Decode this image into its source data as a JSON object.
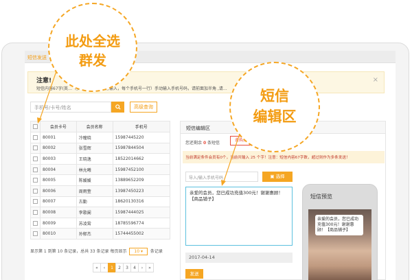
{
  "top_tab": "短信发送",
  "callouts": {
    "left_line1": "此处全选",
    "left_line2": "群发",
    "right_line1": "短信",
    "right_line2": "编辑区"
  },
  "notice": {
    "title": "注意!",
    "text": "短信内容67字(英…（多个手机号码换行输入，每个手机号一行）手动输入手机号码，请前面加半角 ,请…",
    "close": "×"
  },
  "search": {
    "placeholder": "手机号/卡号/姓名",
    "button_icon": "search-icon",
    "query_label": "高级查询"
  },
  "table": {
    "headers": [
      "会员卡号",
      "会员名称",
      "手机号"
    ],
    "rows": [
      [
        "80001",
        "冷瞳晓",
        "15987445220"
      ],
      [
        "80002",
        "张雪辉",
        "15987844504"
      ],
      [
        "80003",
        "王晓逸",
        "18522014662"
      ],
      [
        "80004",
        "林允曦",
        "15987452100"
      ],
      [
        "80005",
        "陈媛媛",
        "13889652209"
      ],
      [
        "80006",
        "周雨萱",
        "13987450223"
      ],
      [
        "80007",
        "古勤",
        "18620130316"
      ],
      [
        "80008",
        "李歌阑",
        "15987444025"
      ],
      [
        "80009",
        "苏凌霄",
        "18785596774"
      ],
      [
        "80010",
        "孙郁杰",
        "15744455002"
      ]
    ]
  },
  "pagination": {
    "info_before": "显示第 1 到第 10 条记录，总共 33 条记录 每页显示",
    "page_size": "10",
    "info_after": "条记录",
    "items": [
      "«",
      "‹",
      "1",
      "2",
      "3",
      "4",
      "›",
      "»"
    ],
    "active": "1"
  },
  "editor": {
    "title": "短信编辑区",
    "remain_prefix": "您还剩余",
    "remain_count": "0",
    "remain_suffix": "条短信",
    "buy_label": "去购买",
    "warning": "当前满足条件会员有0个，当前共输入 25 个字！注意：短信内容67字数，超过则作为多条发送！",
    "phone_placeholder": "导入/输入手机号码",
    "select_label": "选择",
    "message": "亲爱的会员，您已成功充值300元！谢谢惠顾！【商品铺子】",
    "date": "2017-04-14",
    "send_label": "发送"
  },
  "preview": {
    "title": "短信预览",
    "bubble": "亲爱的会员，您已成功充值300元！谢谢惠顾！【商品铺子】"
  },
  "colors": {
    "accent": "#f5a623",
    "danger": "#e74c3c",
    "info_border": "#5bc0de"
  }
}
